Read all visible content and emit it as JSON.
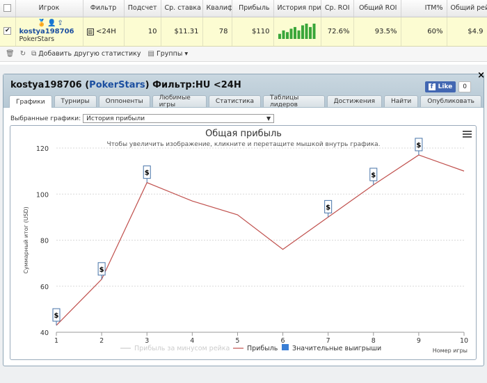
{
  "table": {
    "headers": [
      "Игрок",
      "Фильтр",
      "Подсчет",
      "Ср. ставка",
      "Квалиф",
      "Прибыль",
      "История прибыл",
      "Ср. ROI",
      "Общий ROI",
      "ITM%",
      "Общий рейк"
    ],
    "row": {
      "checked": "✔",
      "player": "kostya198706",
      "site": "PokerStars",
      "filter": "<24H",
      "count": "10",
      "avg_stake": "$11.31",
      "qualif": "78",
      "profit": "$110",
      "avg_roi": "72.6%",
      "total_roi": "93.5%",
      "itm": "60%",
      "rake": "$4.9",
      "spark_values": [
        3,
        5,
        4,
        6,
        7,
        5,
        8,
        9,
        7,
        9
      ]
    }
  },
  "toolbar": {
    "add_stats": "Добавить другую статистику",
    "groups": "Группы"
  },
  "dialog": {
    "player": "kostya198706",
    "site": "PokerStars",
    "filter_text": "Фильтр:HU <24H",
    "like_label": "Like",
    "like_count": "0",
    "tabs": [
      "Графики",
      "Турниры",
      "Оппоненты",
      "Любимые игры",
      "Статистика",
      "Таблицы лидеров",
      "Достижения",
      "Найти",
      "Опубликовать"
    ],
    "select_label": "Выбранные графики:",
    "select_value": "История прибыли"
  },
  "chart_data": {
    "type": "line",
    "title": "Общая прибыль",
    "subtitle": "Чтобы увеличить изображение, кликните и перетащите мышкой внутрь графика.",
    "xlabel": "Номер игры",
    "ylabel": "Суммарный итог (USD)",
    "x": [
      1,
      2,
      3,
      4,
      5,
      6,
      7,
      8,
      9,
      10
    ],
    "xlim": [
      1,
      10
    ],
    "ylim": [
      40,
      120
    ],
    "yticks": [
      40,
      60,
      80,
      100,
      120
    ],
    "series": [
      {
        "name": "Прибыль за минусом рейка",
        "values": [],
        "color": "#cccccc"
      },
      {
        "name": "Прибыль",
        "values": [
          43,
          63,
          105,
          97,
          91,
          76,
          90,
          104,
          117,
          110
        ],
        "color": "#c0504d"
      }
    ],
    "flags": {
      "name": "Значительные выигрыши",
      "label": "$",
      "x": [
        1,
        2,
        3,
        7,
        8,
        9
      ]
    },
    "grid": true,
    "legend": "bottom"
  }
}
